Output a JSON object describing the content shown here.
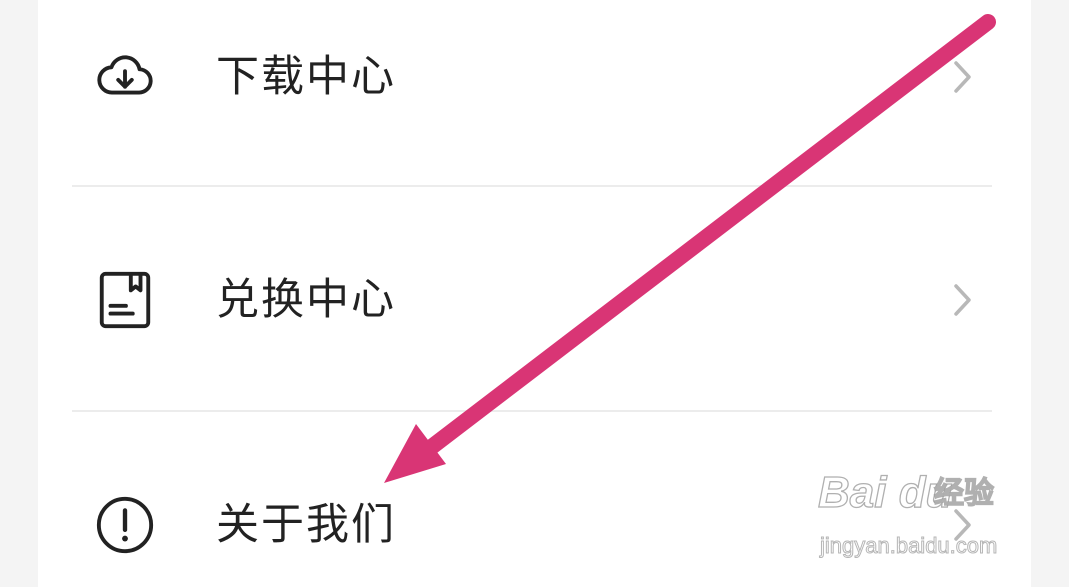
{
  "menu": {
    "items": [
      {
        "label": "下载中心",
        "icon": "cloud-download-icon"
      },
      {
        "label": "兑换中心",
        "icon": "voucher-book-icon"
      },
      {
        "label": "关于我们",
        "icon": "info-exclamation-icon"
      }
    ]
  },
  "overlay": {
    "annotation": "pink-arrow-pointing-to-about-us",
    "arrow_color": "#d93575"
  },
  "watermark": {
    "brand": "Bai du",
    "product": "经验",
    "url": "jingyan.baidu.com"
  },
  "colors": {
    "background": "#f4f4f4",
    "panel": "#ffffff",
    "text": "#222222",
    "icon": "#222222",
    "chevron": "#b8b8b8",
    "divider": "#ececec"
  }
}
